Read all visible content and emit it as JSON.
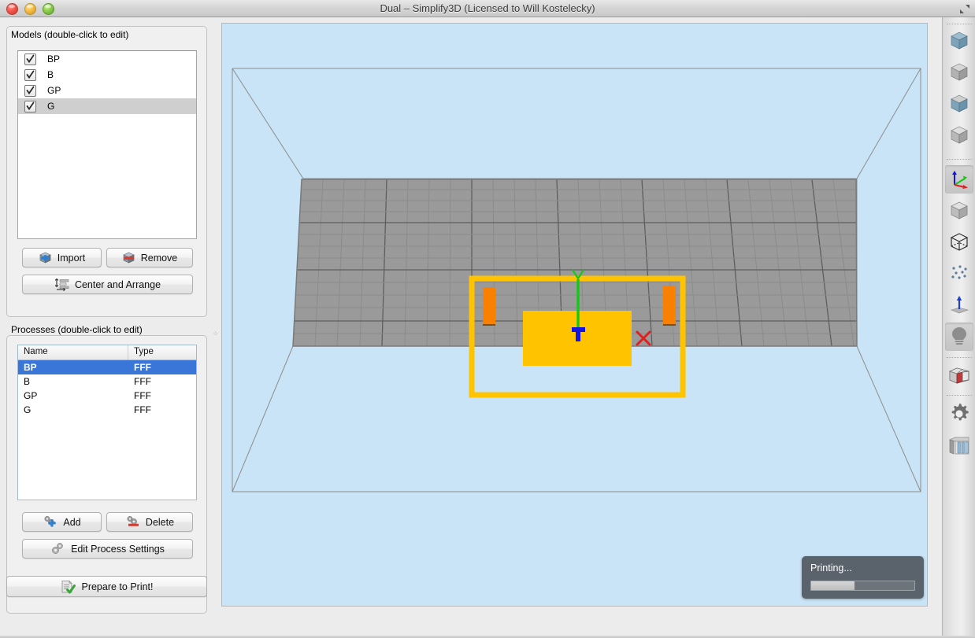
{
  "window": {
    "title": "Dual – Simplify3D (Licensed to Will Kostelecky)",
    "close_icon": "close-traffic-light",
    "minimize_icon": "minimize-traffic-light",
    "zoom_icon": "zoom-traffic-light",
    "fullscreen_icon": "fullscreen-arrows-icon"
  },
  "models": {
    "group_label": "Models (double-click to edit)",
    "items": [
      {
        "name": "BP",
        "checked": true,
        "selected": false
      },
      {
        "name": "B",
        "checked": true,
        "selected": false
      },
      {
        "name": "GP",
        "checked": true,
        "selected": false
      },
      {
        "name": "G",
        "checked": true,
        "selected": true
      }
    ],
    "import_label": "Import",
    "import_icon": "import-cube-plus-icon",
    "remove_label": "Remove",
    "remove_icon": "remove-cube-minus-icon",
    "center_label": "Center and Arrange",
    "center_icon": "center-arrange-icon"
  },
  "processes": {
    "group_label": "Processes (double-click to edit)",
    "columns": [
      "Name",
      "Type"
    ],
    "rows": [
      {
        "name": "BP",
        "type": "FFF",
        "selected": true
      },
      {
        "name": "B",
        "type": "FFF",
        "selected": false
      },
      {
        "name": "GP",
        "type": "FFF",
        "selected": false
      },
      {
        "name": "G",
        "type": "FFF",
        "selected": false
      }
    ],
    "add_label": "Add",
    "add_icon": "add-gear-plus-icon",
    "delete_label": "Delete",
    "delete_icon": "delete-gear-minus-icon",
    "edit_label": "Edit Process Settings",
    "edit_icon": "gears-icon"
  },
  "prepare": {
    "label": "Prepare to Print!",
    "icon": "prepare-checklist-check-icon"
  },
  "status": {
    "label": "Printing...",
    "progress_percent": 42
  },
  "toolbar": {
    "items": [
      {
        "name": "model-view-blue-cube-1",
        "icon": "cube-blue-icon",
        "active": false
      },
      {
        "name": "model-view-gray-cube-1",
        "icon": "cube-gray-icon",
        "active": false
      },
      {
        "name": "model-view-blue-cube-2",
        "icon": "cube-blue-icon",
        "active": false
      },
      {
        "name": "model-view-gray-cube-2",
        "icon": "cube-gray-icon",
        "active": false
      },
      {
        "name": "axes-view",
        "icon": "xyz-axes-icon",
        "active": true
      },
      {
        "name": "solid-view",
        "icon": "solid-cube-icon",
        "active": false
      },
      {
        "name": "wireframe-view",
        "icon": "wireframe-cube-icon",
        "active": false
      },
      {
        "name": "vertices-view",
        "icon": "point-cloud-icon",
        "active": false
      },
      {
        "name": "normals-view",
        "icon": "normal-arrow-icon",
        "active": false
      },
      {
        "name": "lighting-toggle",
        "icon": "lightbulb-icon",
        "active": true
      },
      {
        "name": "cross-section-view",
        "icon": "cross-section-cube-icon",
        "active": false
      },
      {
        "name": "settings",
        "icon": "gear-icon",
        "active": false
      },
      {
        "name": "supports",
        "icon": "supports-icon",
        "active": false
      }
    ]
  },
  "viewport": {
    "background_color": "#c9e4f7",
    "bed_color": "#9a9a9a",
    "skirt_color": "#ffc300",
    "part_color": "#ffc300",
    "support_color": "#f98000",
    "axis_x_color": "#e02020",
    "axis_y_color": "#14c814",
    "axis_z_color": "#1414e0",
    "axis_x_label": "X",
    "axis_y_label": "Y",
    "grid_columns": 26,
    "grid_rows": 14
  }
}
